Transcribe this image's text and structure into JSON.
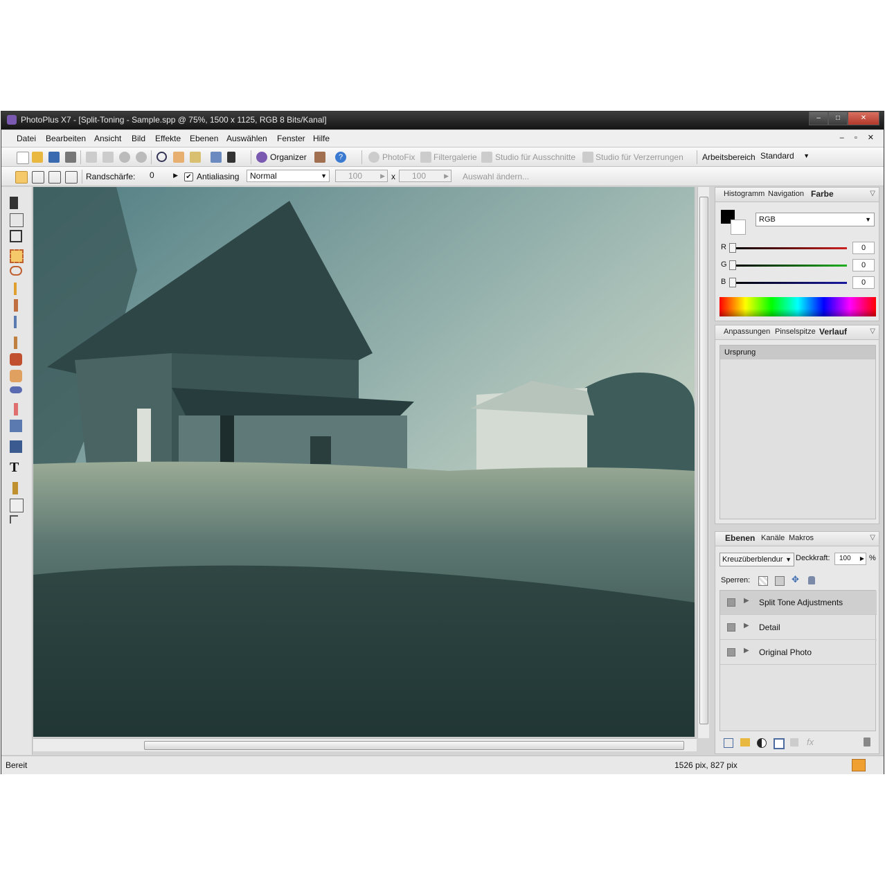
{
  "window": {
    "title": "PhotoPlus X7 - [Split-Toning - Sample.spp @ 75%, 1500 x 1125, RGB 8 Bits/Kanal]",
    "controls": {
      "minimize": "–",
      "maximize": "□",
      "close": "✕"
    }
  },
  "menu": [
    "Datei",
    "Bearbeiten",
    "Ansicht",
    "Bild",
    "Effekte",
    "Ebenen",
    "Auswählen",
    "Fenster",
    "Hilfe"
  ],
  "mdi_controls": "– ▫ ✕",
  "toolbar1": {
    "organizer": "Organizer",
    "photofix": "PhotoFix",
    "filtergalerie": "Filtergalerie",
    "studio_ausschnitte": "Studio für Ausschnitte",
    "studio_verzerrungen": "Studio für Verzerrungen",
    "workspace_label": "Arbeitsbereich",
    "workspace_value": "Standard"
  },
  "toolbar2": {
    "feather_label": "Randschärfe:",
    "feather_value": "0",
    "antialias_label": "Antialiasing",
    "mode_value": "Normal",
    "width_value": "100",
    "x_label": "x",
    "height_value": "100",
    "modify_button": "Auswahl ändern..."
  },
  "colors": {
    "accent": "#7a5ab0",
    "selected_tool": "#f5c86a"
  },
  "panel_color": {
    "tabs": [
      "Histogramm",
      "Navigation",
      "Farbe"
    ],
    "active_tab": "Farbe",
    "mode": "RGB",
    "channels": [
      {
        "label": "R",
        "value": "0",
        "color": "#cc2020"
      },
      {
        "label": "G",
        "value": "0",
        "color": "#20b020"
      },
      {
        "label": "B",
        "value": "0",
        "color": "#1a1aa0"
      }
    ]
  },
  "panel_history": {
    "tabs": [
      "Anpassungen",
      "Pinselspitze",
      "Verlauf"
    ],
    "active_tab": "Verlauf",
    "items": [
      "Ursprung"
    ]
  },
  "panel_layers": {
    "tabs": [
      "Ebenen",
      "Kanäle",
      "Makros"
    ],
    "active_tab": "Ebenen",
    "blend_mode": "Kreuzüberblendur",
    "opacity_label": "Deckkraft:",
    "opacity_value": "100",
    "opacity_unit": "%",
    "lock_label": "Sperren:",
    "layers": [
      "Split Tone Adjustments",
      "Detail",
      "Original Photo"
    ]
  },
  "status": {
    "left": "Bereit",
    "coords": "1526 pix, 827 pix"
  }
}
